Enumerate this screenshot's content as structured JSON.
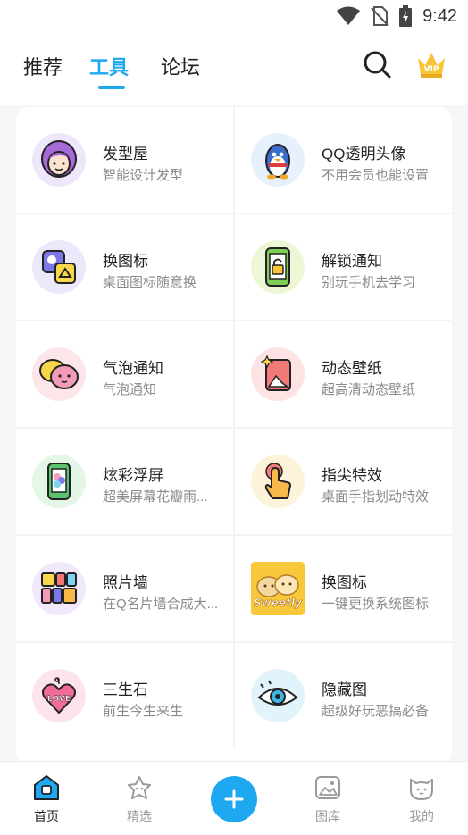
{
  "status": {
    "time": "9:42",
    "icons": [
      "wifi-icon",
      "no-sim-icon",
      "battery-charging-icon"
    ]
  },
  "header": {
    "tabs": [
      {
        "label": "推荐",
        "active": false
      },
      {
        "label": "工具",
        "active": true
      },
      {
        "label": "论坛",
        "active": false
      }
    ],
    "search_icon": "search-icon",
    "vip_icon": "vip-crown-icon"
  },
  "tools": [
    {
      "title": "发型屋",
      "subtitle": "智能设计发型",
      "icon": "hairstyle-girl-icon",
      "bg": "#eee6fb"
    },
    {
      "title": "QQ透明头像",
      "subtitle": "不用会员也能设置",
      "icon": "qq-penguin-icon",
      "bg": "#e6f1fd"
    },
    {
      "title": "换图标",
      "subtitle": "桌面图标随意换",
      "icon": "swap-icons-icon",
      "bg": "#ece8fb"
    },
    {
      "title": "解锁通知",
      "subtitle": "别玩手机去学习",
      "icon": "unlock-phone-icon",
      "bg": "#edf7d6"
    },
    {
      "title": "气泡通知",
      "subtitle": "气泡通知",
      "icon": "chat-bubbles-icon",
      "bg": "#fde6ea"
    },
    {
      "title": "动态壁纸",
      "subtitle": "超高清动态壁纸",
      "icon": "wallpaper-icon",
      "bg": "#fde3e3"
    },
    {
      "title": "炫彩浮屏",
      "subtitle": "超美屏幕花瓣雨...",
      "icon": "float-screen-icon",
      "bg": "#e4f6e6"
    },
    {
      "title": "指尖特效",
      "subtitle": "桌面手指划动特效",
      "icon": "finger-tap-icon",
      "bg": "#fdf3da"
    },
    {
      "title": "照片墙",
      "subtitle": "在Q名片墙合成大...",
      "icon": "photo-wall-icon",
      "bg": "#f1e8fb"
    },
    {
      "title": "换图标",
      "subtitle": "一键更换系统图标",
      "icon": "sweetly-cats-icon",
      "bg": "#f7c93a",
      "badge_text": "Sweetly"
    },
    {
      "title": "三生石",
      "subtitle": "前生今生来生",
      "icon": "love-heart-icon",
      "bg": "#fde3ea",
      "badge_text": "LOVE"
    },
    {
      "title": "隐藏图",
      "subtitle": "超级好玩恶搞必备",
      "icon": "eye-icon",
      "bg": "#e2f4fb"
    }
  ],
  "bottom_nav": [
    {
      "label": "首页",
      "icon": "home-icon",
      "active": true
    },
    {
      "label": "精选",
      "icon": "featured-star-icon",
      "active": false
    },
    {
      "label": "",
      "icon": "plus-icon",
      "active": false
    },
    {
      "label": "图库",
      "icon": "gallery-icon",
      "active": false
    },
    {
      "label": "我的",
      "icon": "profile-cat-icon",
      "active": false
    }
  ],
  "colors": {
    "accent": "#1ea8f0",
    "text": "#222222",
    "subtext": "#8a8a8a"
  }
}
